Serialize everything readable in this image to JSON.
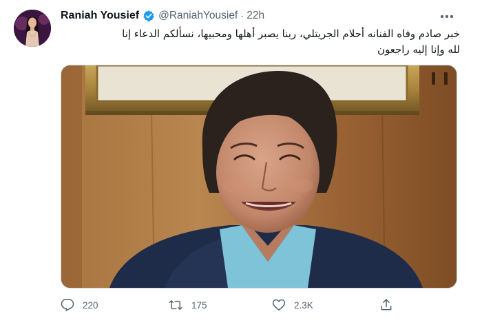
{
  "tweet": {
    "display_name": "Raniah Yousief",
    "handle": "@RaniahYousief",
    "separator": "·",
    "time": "22h",
    "verified": true,
    "text_lines": [
      "خبر صادم وفاه الفنانه أحلام الجريتلي، ربنا يصبر أهلها ومحبيها، نسألكم الدعاء إنا",
      "لله وإنا إليه راجعون"
    ]
  },
  "actions": {
    "reply": {
      "icon": "reply-icon",
      "count": "220"
    },
    "retweet": {
      "icon": "retweet-icon",
      "count": "175"
    },
    "like": {
      "icon": "heart-icon",
      "count": "2.3K"
    },
    "share": {
      "icon": "share-icon"
    }
  },
  "colors": {
    "text_primary": "#0f1419",
    "text_secondary": "#536471",
    "verified_badge": "#1d9bf0",
    "border": "#cfd9de"
  }
}
